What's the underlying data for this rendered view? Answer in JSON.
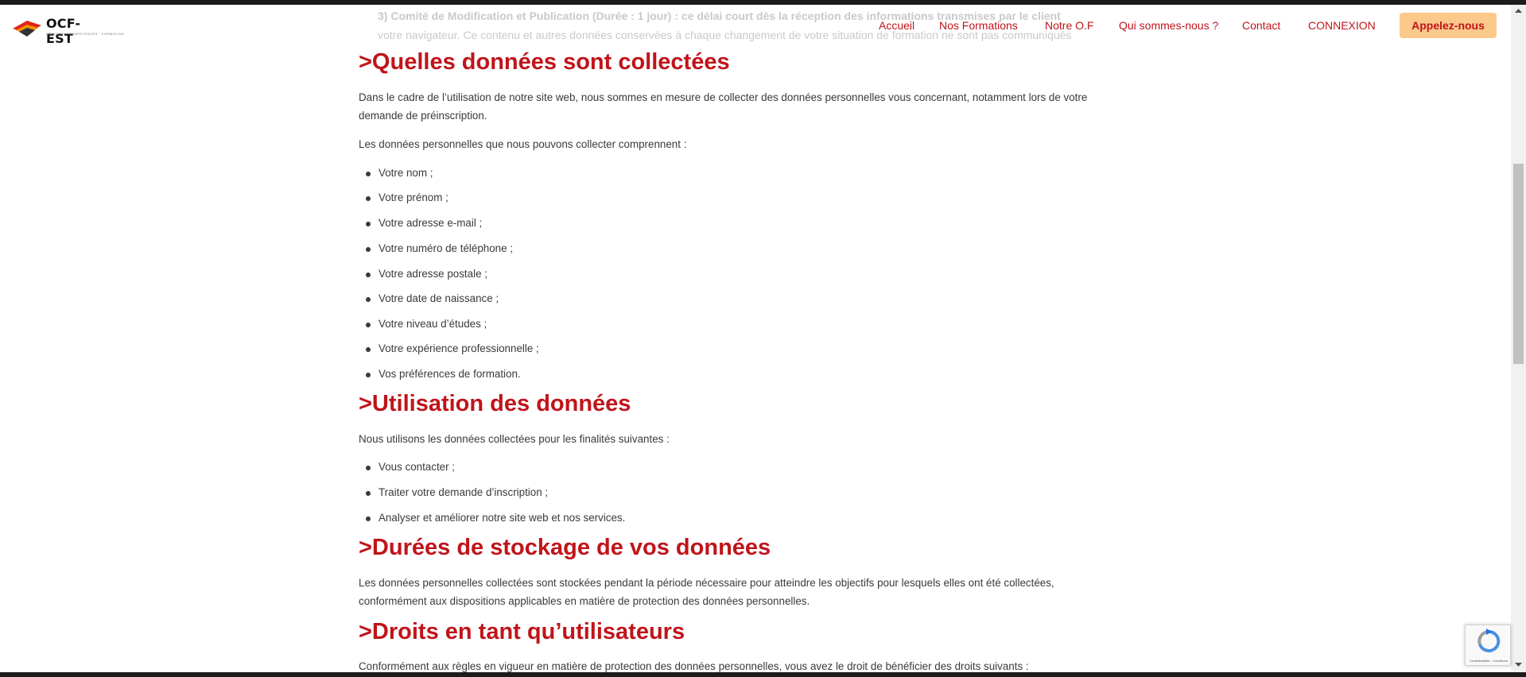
{
  "header": {
    "logo_text": "OCF-EST",
    "logo_tagline": "OBJECTIF · COMPETENCES · FORMATION",
    "nav": [
      "Accueil",
      "Nos Formations",
      "Notre O.F",
      "Qui sommes-nous ?",
      "Contact",
      "CONNEXION"
    ],
    "cta_label": "Appelez-nous"
  },
  "peek": {
    "line1": "3) Comité de Modification et Publication (Durée : 1 jour) : ce délai court dès la réception des informations transmises par le client",
    "line2": "votre navigateur. Ce contenu et autres données conservées à chaque changement de votre situation de formation ne sont pas communiqués"
  },
  "sections": {
    "collected": {
      "title": ">Quelles données sont collectées",
      "intro": "Dans le cadre de l’utilisation de notre site web, nous sommes en mesure de collecter des données personnelles vous concernant, notamment lors de votre demande de préinscription.",
      "lead": "Les données personnelles que nous pouvons collecter comprennent :",
      "items": [
        "Votre nom ;",
        "Votre prénom ;",
        "Votre adresse e-mail ;",
        "Votre numéro de téléphone ;",
        "Votre adresse postale ;",
        "Votre date de naissance ;",
        "Votre niveau d’études ;",
        "Votre expérience professionnelle ;",
        "Vos préférences de formation."
      ]
    },
    "usage": {
      "title": ">Utilisation des données",
      "intro": "Nous utilisons les données collectées pour les finalités suivantes :",
      "items": [
        "Vous contacter ;",
        "Traiter votre demande d’inscription ;",
        "Analyser et améliorer notre site web et nos services."
      ]
    },
    "storage": {
      "title": ">Durées de stockage de vos données",
      "text": "Les données personnelles collectées sont stockées pendant la période nécessaire pour atteindre les objectifs pour lesquels elles ont été collectées, conformément aux dispositions applicables en matière de protection des données personnelles."
    },
    "rights": {
      "title": ">Droits en tant qu’utilisateurs",
      "text": "Conformément aux règles en vigueur en matière de protection des données personnelles, vous avez le droit de bénéficier des droits suivants :"
    }
  },
  "recaptcha": {
    "footer": "Confidentialité - Conditions"
  },
  "colors": {
    "accent_red": "#c0141a",
    "cta_bg": "#fbc98a",
    "text": "#3a3a3a"
  }
}
